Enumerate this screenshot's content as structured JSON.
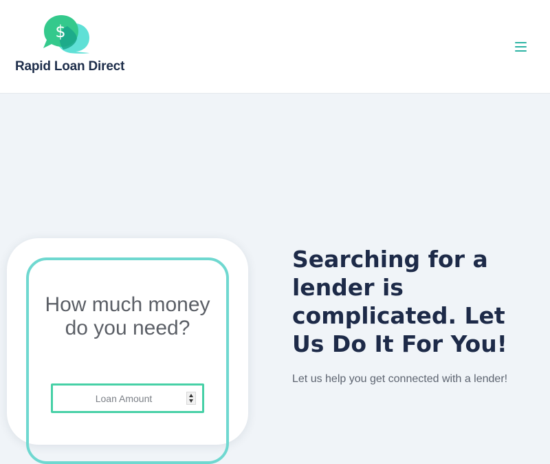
{
  "header": {
    "brand": "Rapid Loan Direct",
    "logo_icon": "dollar-chat-bubbles-icon",
    "menu_icon": "hamburger-menu-icon",
    "accent_color": "#2bb3a3"
  },
  "card": {
    "title": "How much money do you need?",
    "amount_placeholder": "Loan Amount",
    "spinner_icon": "number-spinner-icon",
    "border_color": "#6fd8d0",
    "field_border_color": "#46d0a6"
  },
  "hero": {
    "title": "Searching for a lender is complicated. Let Us Do It For You!",
    "subtitle": "Let us help you get connected with a lender!"
  }
}
